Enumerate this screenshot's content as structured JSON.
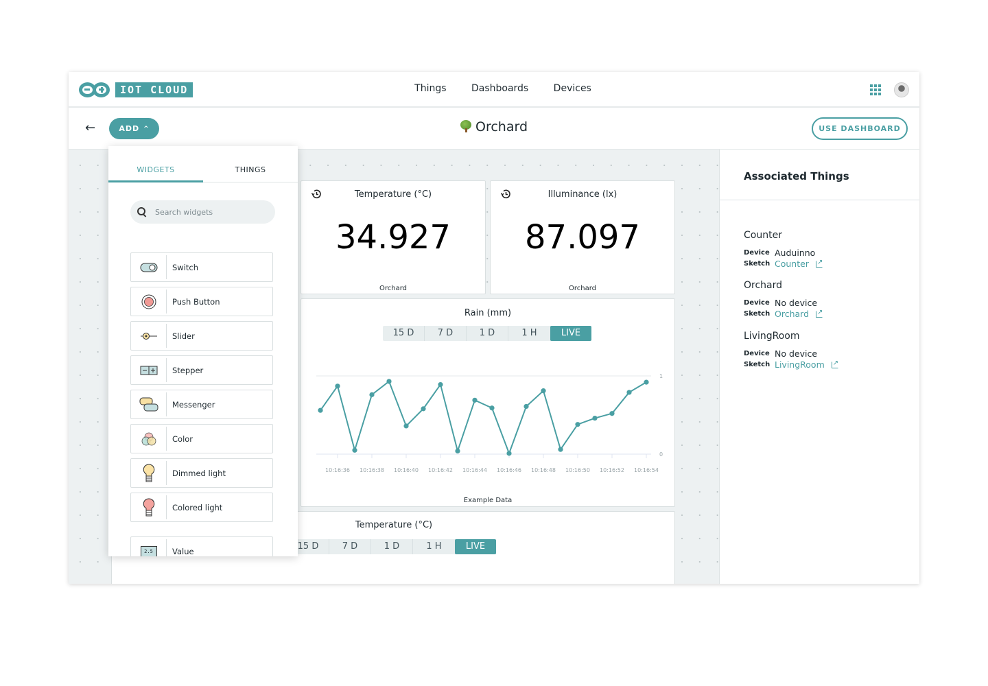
{
  "app": {
    "logo_text": "IOT CLOUD",
    "nav": [
      "Things",
      "Dashboards",
      "Devices"
    ],
    "apps_icon": "grid-icon",
    "avatar": "user-avatar"
  },
  "toolbar": {
    "back_icon": "arrow-left-icon",
    "add_label": "ADD",
    "title": "Orchard",
    "title_icon": "tree-icon",
    "use_dashboard_label": "USE DASHBOARD"
  },
  "add_panel": {
    "tabs": [
      {
        "label": "WIDGETS",
        "active": true
      },
      {
        "label": "THINGS",
        "active": false
      }
    ],
    "search_placeholder": "Search widgets",
    "widgets": [
      {
        "label": "Switch",
        "icon": "switch-icon"
      },
      {
        "label": "Push Button",
        "icon": "push-button-icon"
      },
      {
        "label": "Slider",
        "icon": "slider-icon"
      },
      {
        "label": "Stepper",
        "icon": "stepper-icon"
      },
      {
        "label": "Messenger",
        "icon": "messenger-icon"
      },
      {
        "label": "Color",
        "icon": "color-icon"
      },
      {
        "label": "Dimmed light",
        "icon": "dimmed-light-icon"
      },
      {
        "label": "Colored light",
        "icon": "colored-light-icon"
      },
      {
        "label": "Value",
        "icon": "value-icon",
        "icon_text": "2.5"
      }
    ]
  },
  "dashboard": {
    "value_cards": [
      {
        "title": "Temperature (°C)",
        "value": "34.927",
        "thing": "Orchard"
      },
      {
        "title": "Illuminance (lx)",
        "value": "87.097",
        "thing": "Orchard"
      }
    ],
    "chart_card": {
      "title": "Rain (mm)",
      "ranges": [
        "15 D",
        "7 D",
        "1 D",
        "1 H",
        "LIVE"
      ],
      "active_range": "LIVE",
      "footer": "Example Data"
    },
    "bottom_card": {
      "title": "Temperature (°C)",
      "ranges": [
        "15 D",
        "7 D",
        "1 D",
        "1 H",
        "LIVE"
      ],
      "active_range": "LIVE"
    }
  },
  "chart_data": {
    "type": "line",
    "title": "Rain (mm)",
    "xlabel": "",
    "ylabel": "",
    "footer": "Example Data",
    "x": [
      "10:16:35",
      "10:16:36",
      "10:16:37",
      "10:16:38",
      "10:16:39",
      "10:16:40",
      "10:16:41",
      "10:16:42",
      "10:16:43",
      "10:16:44",
      "10:16:45",
      "10:16:46",
      "10:16:47",
      "10:16:48",
      "10:16:49",
      "10:16:50",
      "10:16:51",
      "10:16:52",
      "10:16:53",
      "10:16:54"
    ],
    "xticks": [
      "10:16:36",
      "10:16:38",
      "10:16:40",
      "10:16:42",
      "10:16:44",
      "10:16:46",
      "10:16:48",
      "10:16:50",
      "10:16:52",
      "10:16:54"
    ],
    "yticks": [
      "0",
      "1"
    ],
    "ylim": [
      0,
      1
    ],
    "series": [
      {
        "name": "Rain (mm)",
        "color": "#4a9fa3",
        "values": [
          0.56,
          0.87,
          0.05,
          0.76,
          0.93,
          0.36,
          0.58,
          0.89,
          0.04,
          0.69,
          0.59,
          0.01,
          0.61,
          0.81,
          0.06,
          0.38,
          0.46,
          0.52,
          0.79,
          0.92
        ]
      }
    ],
    "grid": true
  },
  "associated": {
    "title": "Associated Things",
    "device_key": "Device",
    "sketch_key": "Sketch",
    "things": [
      {
        "name": "Counter",
        "device": "Auduinno",
        "sketch": "Counter"
      },
      {
        "name": "Orchard",
        "device": "No device",
        "sketch": "Orchard"
      },
      {
        "name": "LivingRoom",
        "device": "No device",
        "sketch": "LivingRoom"
      }
    ]
  },
  "colors": {
    "accent": "#4a9fa3",
    "canvas_bg": "#edf1f2",
    "text": "#1f2a30"
  }
}
